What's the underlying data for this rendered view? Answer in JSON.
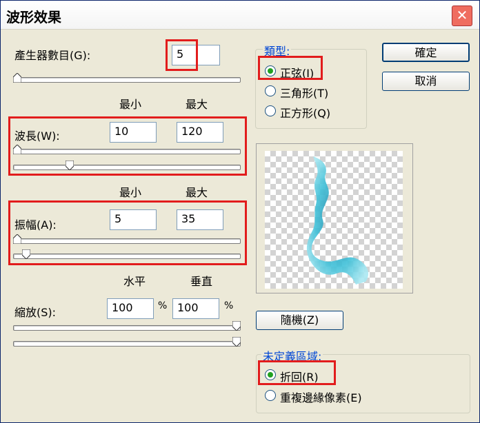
{
  "window": {
    "title": "波形效果",
    "close_icon": "close-icon"
  },
  "generators": {
    "label": "產生器數目(G):",
    "value": "5",
    "slider_fraction": 0.0
  },
  "col_headers_1": {
    "min": "最小",
    "max": "最大"
  },
  "wavelength": {
    "label": "波長(W):",
    "min": "10",
    "max": "120",
    "min_fraction": 0.0,
    "max_fraction": 0.12
  },
  "col_headers_2": {
    "min": "最小",
    "max": "最大"
  },
  "amplitude": {
    "label": "振幅(A):",
    "min": "5",
    "max": "35",
    "min_fraction": 0.0,
    "max_fraction": 0.04
  },
  "scale_headers": {
    "horizontal": "水平",
    "vertical": "垂直"
  },
  "scale": {
    "label": "縮放(S):",
    "horizontal": "100",
    "vertical": "100",
    "unit": "%",
    "h_fraction": 1.0,
    "v_fraction": 1.0
  },
  "type_group": {
    "label": "類型:",
    "options": [
      "正弦(I)",
      "三角形(T)",
      "正方形(Q)"
    ],
    "selected": 0
  },
  "buttons": {
    "ok": "確定",
    "cancel": "取消",
    "randomize": "隨機(Z)"
  },
  "undefined_group": {
    "label": "未定義區域:",
    "options": [
      "折回(R)",
      "重複邊緣像素(E)"
    ],
    "selected": 0
  },
  "colors": {
    "highlight": "#e21c1c",
    "wave": "#3fc0d8",
    "group_label": "#0046d5"
  }
}
